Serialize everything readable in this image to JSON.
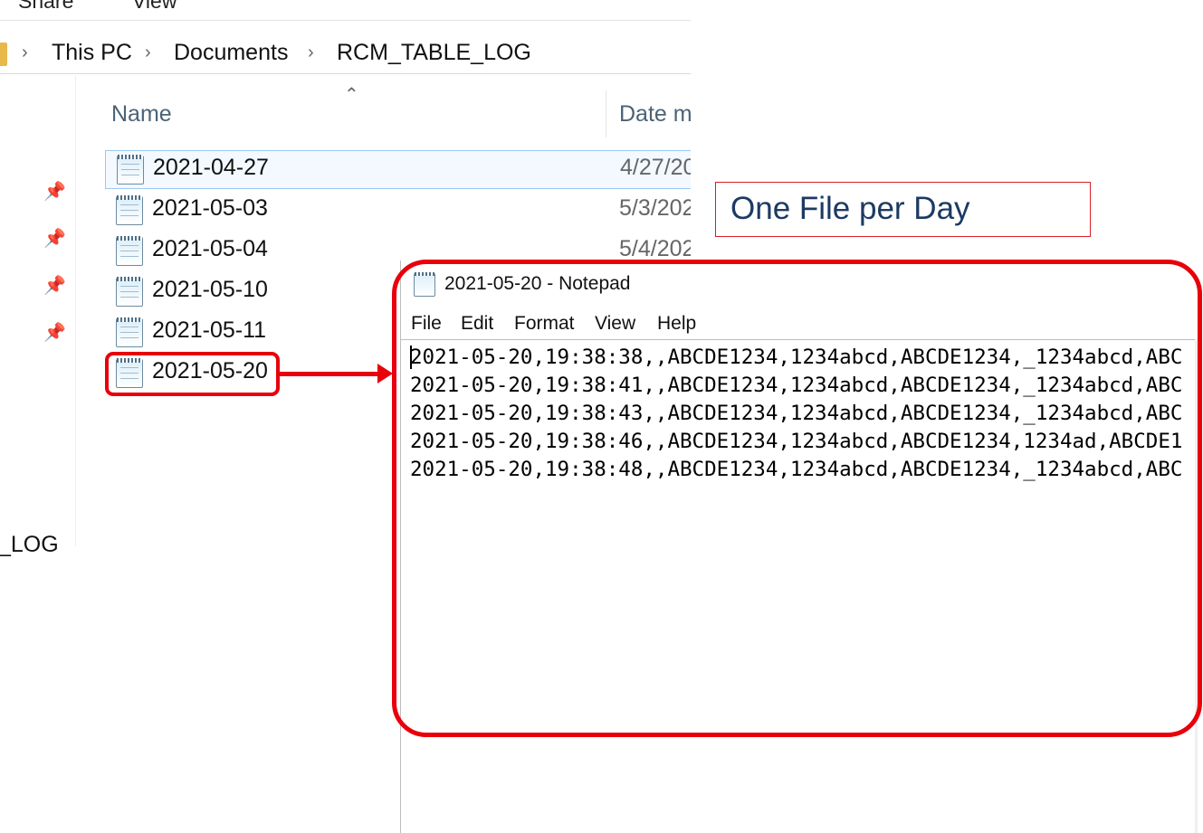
{
  "explorer": {
    "ribbon": {
      "tabs": [
        "Share",
        "View"
      ]
    },
    "breadcrumb": {
      "items": [
        "This PC",
        "Documents",
        "RCM_TABLE_LOG"
      ],
      "separator": "›"
    },
    "navpane": {
      "folder_label": "_LOG"
    },
    "columns": {
      "name": "Name",
      "date": "Date m"
    },
    "files": [
      {
        "name": "2021-04-27",
        "date": "4/27/20",
        "selected": true
      },
      {
        "name": "2021-05-03",
        "date": "5/3/202"
      },
      {
        "name": "2021-05-04",
        "date": "5/4/202"
      },
      {
        "name": "2021-05-10",
        "date": ""
      },
      {
        "name": "2021-05-11",
        "date": ""
      },
      {
        "name": "2021-05-20",
        "date": ""
      }
    ]
  },
  "callout": {
    "text": "One File per Day"
  },
  "notepad": {
    "title": "2021-05-20 - Notepad",
    "menu": [
      "File",
      "Edit",
      "Format",
      "View",
      "Help"
    ],
    "lines": [
      "2021-05-20,19:38:38,,ABCDE1234,1234abcd,ABCDE1234,_1234abcd,ABC",
      "2021-05-20,19:38:41,,ABCDE1234,1234abcd,ABCDE1234,_1234abcd,ABC",
      "2021-05-20,19:38:43,,ABCDE1234,1234abcd,ABCDE1234,_1234abcd,ABC",
      "2021-05-20,19:38:46,,ABCDE1234,1234abcd,ABCDE1234,1234ad,ABCDE1",
      "2021-05-20,19:38:48,,ABCDE1234,1234abcd,ABCDE1234,_1234abcd,ABC"
    ]
  },
  "colors": {
    "annotation_red": "#e8000b",
    "callout_text": "#1c3a63",
    "selection": "#99c9ef"
  }
}
